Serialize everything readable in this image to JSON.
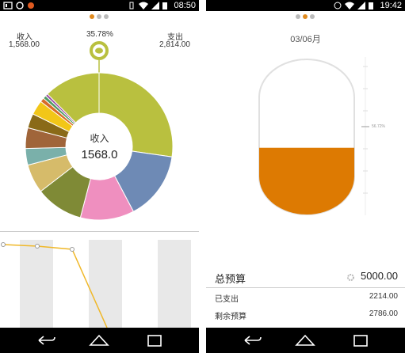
{
  "left": {
    "status": {
      "time": "08:50"
    },
    "pager": {
      "count": 3,
      "active": 0
    },
    "income": {
      "label": "收入",
      "amount": "1,568.00"
    },
    "percent": "35.78%",
    "expense": {
      "label": "支出",
      "amount": "2,814.00"
    },
    "center": {
      "label": "收入",
      "value": "1568.0"
    },
    "donut_slices": [
      {
        "value": 30.0,
        "color": "#b9c03f"
      },
      {
        "value": 16.5,
        "color": "#6e8ab5"
      },
      {
        "value": 13.0,
        "color": "#ef8fbf"
      },
      {
        "value": 11.5,
        "color": "#7f8a36"
      },
      {
        "value": 7.0,
        "color": "#d6bb6a"
      },
      {
        "value": 4.0,
        "color": "#7ab0aa"
      },
      {
        "value": 5.0,
        "color": "#a0653a"
      },
      {
        "value": 3.5,
        "color": "#8a6a18"
      },
      {
        "value": 3.5,
        "color": "#f2c618"
      },
      {
        "value": 1.0,
        "color": "#d66b2a"
      },
      {
        "value": 0.8,
        "color": "#4f9a65"
      },
      {
        "value": 0.6,
        "color": "#9a4fa3"
      },
      {
        "value": 13.6,
        "color": "#b9c03f"
      }
    ],
    "colors": {
      "accent": "#b9c03f",
      "line": "#f0b829"
    }
  },
  "right": {
    "status": {
      "time": "19:42"
    },
    "pager": {
      "count": 3,
      "active": 1
    },
    "date": "03/06月",
    "gauge": {
      "fill_fraction": 0.43,
      "percent_label": "56.72%",
      "color": "#dd7a02"
    },
    "budget": {
      "title": "总预算",
      "total": "5000.00",
      "rows": [
        {
          "label": "已支出",
          "value": "2214.00"
        },
        {
          "label": "剩余预算",
          "value": "2786.00"
        }
      ]
    }
  }
}
